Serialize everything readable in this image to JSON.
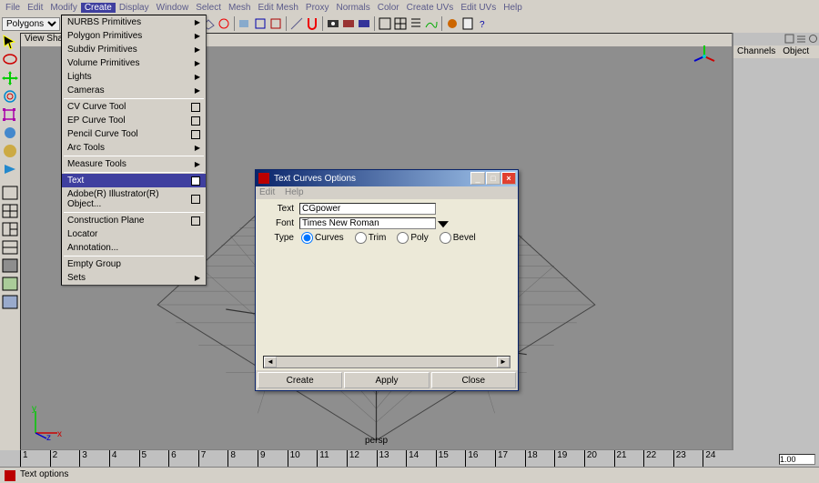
{
  "menubar": [
    "File",
    "Edit",
    "Modify",
    "Create",
    "Display",
    "Window",
    "Select",
    "Mesh",
    "Edit Mesh",
    "Proxy",
    "Normals",
    "Color",
    "Create UVs",
    "Edit UVs",
    "Help"
  ],
  "menubar_active_index": 3,
  "toolbar_dropdown": "Polygons",
  "viewport_header": "View  Shading",
  "viewport_label": "persp",
  "right_panel": {
    "tabs": [
      "Channels",
      "Object"
    ]
  },
  "axis": {
    "x": "x",
    "y": "y",
    "z": "z"
  },
  "create_menu": {
    "groups": [
      [
        {
          "label": "NURBS Primitives",
          "sub": true
        },
        {
          "label": "Polygon Primitives",
          "sub": true
        },
        {
          "label": "Subdiv Primitives",
          "sub": true
        },
        {
          "label": "Volume Primitives",
          "sub": true
        },
        {
          "label": "Lights",
          "sub": true
        },
        {
          "label": "Cameras",
          "sub": true
        }
      ],
      [
        {
          "label": "CV Curve Tool",
          "opt": true
        },
        {
          "label": "EP Curve Tool",
          "opt": true
        },
        {
          "label": "Pencil Curve Tool",
          "opt": true
        },
        {
          "label": "Arc Tools",
          "sub": true
        }
      ],
      [
        {
          "label": "Measure Tools",
          "sub": true
        }
      ],
      [
        {
          "label": "Text",
          "opt": true,
          "highlight": true
        },
        {
          "label": "Adobe(R) Illustrator(R) Object...",
          "opt": true
        }
      ],
      [
        {
          "label": "Construction Plane",
          "opt": true
        },
        {
          "label": "Locator"
        },
        {
          "label": "Annotation..."
        }
      ],
      [
        {
          "label": "Empty Group"
        },
        {
          "label": "Sets",
          "sub": true
        }
      ]
    ]
  },
  "dialog": {
    "title": "Text Curves Options",
    "menus": [
      "Edit",
      "Help"
    ],
    "text_label": "Text",
    "text_value": "CGpower",
    "font_label": "Font",
    "font_value": "Times New Roman",
    "type_label": "Type",
    "type_options": [
      "Curves",
      "Trim",
      "Poly",
      "Bevel"
    ],
    "type_selected": 0,
    "buttons": {
      "create": "Create",
      "apply": "Apply",
      "close": "Close"
    }
  },
  "status_message": "Text options",
  "frame_current": "1.00",
  "timeline_ticks": [
    "1",
    "2",
    "3",
    "4",
    "5",
    "6",
    "7",
    "8",
    "9",
    "10",
    "11",
    "12",
    "13",
    "14",
    "15",
    "16",
    "17",
    "18",
    "19",
    "20",
    "21",
    "22",
    "23",
    "24"
  ]
}
